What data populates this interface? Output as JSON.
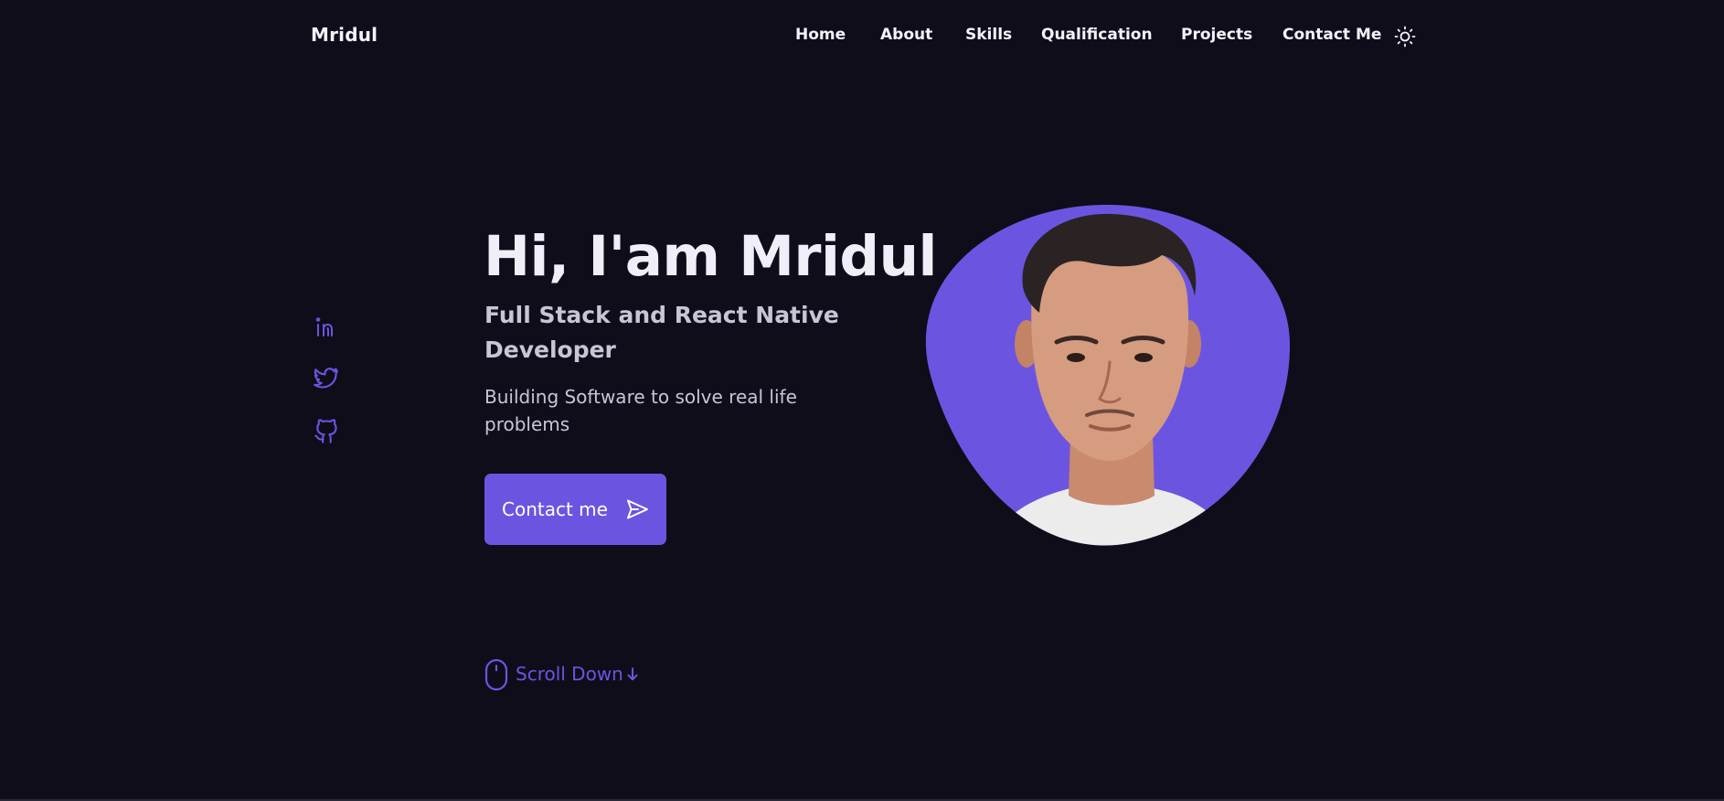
{
  "header": {
    "logo": "Mridul",
    "nav": [
      "Home",
      "About",
      "Skills",
      "Qualification",
      "Projects",
      "Contact Me"
    ],
    "theme_icon": "sun-icon"
  },
  "social": [
    {
      "name": "linkedin",
      "icon": "linkedin-icon"
    },
    {
      "name": "twitter",
      "icon": "twitter-icon"
    },
    {
      "name": "github",
      "icon": "github-icon"
    }
  ],
  "hero": {
    "title": "Hi, I'am Mridul",
    "subtitle": "Full Stack and React Native Developer",
    "description": "Building Software to solve real life problems",
    "button_label": "Contact me",
    "button_icon": "send-icon"
  },
  "scroll": {
    "label": "Scroll Down",
    "mouse_icon": "mouse-icon",
    "arrow_icon": "arrow-down-icon"
  },
  "colors": {
    "background": "#0f0d1a",
    "accent": "#6b55e0",
    "text": "#f0eef7",
    "muted_text": "#c9c5d6"
  }
}
